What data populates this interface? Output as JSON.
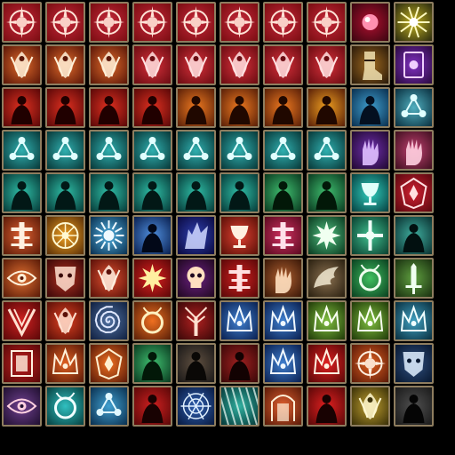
{
  "frame_color": "#8e7d5f",
  "icons": [
    {
      "name": "sun-compass-icon",
      "glyph": "compass",
      "bg": "#7a0d12",
      "mid": "#c8283a",
      "fg": "#ffe2d6"
    },
    {
      "name": "sun-compass-icon",
      "glyph": "compass",
      "bg": "#7a0d12",
      "mid": "#c8283a",
      "fg": "#ffe2d6"
    },
    {
      "name": "sun-compass-icon",
      "glyph": "compass",
      "bg": "#7a0d12",
      "mid": "#c8283a",
      "fg": "#ffe2d6"
    },
    {
      "name": "sun-compass-icon",
      "glyph": "compass",
      "bg": "#7a0d12",
      "mid": "#c8283a",
      "fg": "#ffe2d6"
    },
    {
      "name": "sun-compass-icon",
      "glyph": "compass",
      "bg": "#7a0d12",
      "mid": "#c8283a",
      "fg": "#ffe2d6"
    },
    {
      "name": "sun-compass-icon",
      "glyph": "compass",
      "bg": "#7a0d12",
      "mid": "#c8283a",
      "fg": "#ffe2d6"
    },
    {
      "name": "sun-compass-icon",
      "glyph": "compass",
      "bg": "#7a0d12",
      "mid": "#c8283a",
      "fg": "#ffe2d6"
    },
    {
      "name": "sun-compass-icon",
      "glyph": "compass",
      "bg": "#7a0d12",
      "mid": "#c8283a",
      "fg": "#ffe2d6"
    },
    {
      "name": "crimson-orb-icon",
      "glyph": "orb",
      "bg": "#3a0610",
      "mid": "#b01030",
      "fg": "#ff8fb0"
    },
    {
      "name": "lightning-burst-icon",
      "glyph": "burst",
      "bg": "#2a2a10",
      "mid": "#c0b020",
      "fg": "#fffbc0"
    },
    {
      "name": "flame-spirit-icon",
      "glyph": "flame",
      "bg": "#5a1608",
      "mid": "#e06a2a",
      "fg": "#fff0d8"
    },
    {
      "name": "flame-spirit-icon",
      "glyph": "flame",
      "bg": "#5a1608",
      "mid": "#e06a2a",
      "fg": "#fff0d8"
    },
    {
      "name": "flame-spirit-icon",
      "glyph": "flame",
      "bg": "#5a1608",
      "mid": "#e06a2a",
      "fg": "#fff0d8"
    },
    {
      "name": "flame-spirit-icon",
      "glyph": "flame",
      "bg": "#6a0c12",
      "mid": "#d8303a",
      "fg": "#ffe0e0"
    },
    {
      "name": "flame-spirit-icon",
      "glyph": "flame",
      "bg": "#6a0c12",
      "mid": "#d8303a",
      "fg": "#ffe0e0"
    },
    {
      "name": "flame-spirit-icon",
      "glyph": "flame",
      "bg": "#6a0c12",
      "mid": "#d8303a",
      "fg": "#ffe0e0"
    },
    {
      "name": "flame-spirit-icon",
      "glyph": "flame",
      "bg": "#6a0c12",
      "mid": "#d8303a",
      "fg": "#ffe0e0"
    },
    {
      "name": "flame-spirit-icon",
      "glyph": "flame",
      "bg": "#6a0c12",
      "mid": "#d8303a",
      "fg": "#ffe0e0"
    },
    {
      "name": "armored-boot-icon",
      "glyph": "boot",
      "bg": "#2a1a0a",
      "mid": "#a06a20",
      "fg": "#f0e0b0"
    },
    {
      "name": "arcane-tablet-icon",
      "glyph": "tablet",
      "bg": "#2a0a40",
      "mid": "#8030c0",
      "fg": "#f0d0ff"
    },
    {
      "name": "burning-figure-icon",
      "glyph": "figure",
      "bg": "#5a0808",
      "mid": "#e03020",
      "fg": "#200000"
    },
    {
      "name": "burning-figure-icon",
      "glyph": "figure",
      "bg": "#5a0808",
      "mid": "#e03020",
      "fg": "#200000"
    },
    {
      "name": "burning-figure-icon",
      "glyph": "figure",
      "bg": "#5a0808",
      "mid": "#e03020",
      "fg": "#200000"
    },
    {
      "name": "burning-figure-icon",
      "glyph": "figure",
      "bg": "#5a0808",
      "mid": "#e03020",
      "fg": "#200000"
    },
    {
      "name": "burning-figure-icon",
      "glyph": "figure",
      "bg": "#5a2008",
      "mid": "#f07a20",
      "fg": "#200800"
    },
    {
      "name": "burning-figure-icon",
      "glyph": "figure",
      "bg": "#5a2008",
      "mid": "#f07a20",
      "fg": "#200800"
    },
    {
      "name": "burning-figure-icon",
      "glyph": "figure",
      "bg": "#5a2008",
      "mid": "#f07a20",
      "fg": "#200800"
    },
    {
      "name": "burning-figure-icon",
      "glyph": "figure",
      "bg": "#5a2008",
      "mid": "#f0a020",
      "fg": "#200800"
    },
    {
      "name": "frost-figure-icon",
      "glyph": "figure",
      "bg": "#0a3050",
      "mid": "#40a0d0",
      "fg": "#041020"
    },
    {
      "name": "triad-sigil-icon",
      "glyph": "triad",
      "bg": "#0a3040",
      "mid": "#50b0c0",
      "fg": "#e0ffff"
    },
    {
      "name": "triad-sigil-icon",
      "glyph": "triad",
      "bg": "#083838",
      "mid": "#30b0b0",
      "fg": "#e0ffff"
    },
    {
      "name": "triad-sigil-icon",
      "glyph": "triad",
      "bg": "#083838",
      "mid": "#30b0b0",
      "fg": "#e0ffff"
    },
    {
      "name": "triad-sigil-icon",
      "glyph": "triad",
      "bg": "#083838",
      "mid": "#30b0b0",
      "fg": "#e0ffff"
    },
    {
      "name": "triad-sigil-icon",
      "glyph": "triad",
      "bg": "#083838",
      "mid": "#30b0b0",
      "fg": "#e0ffff"
    },
    {
      "name": "triad-sigil-icon",
      "glyph": "triad",
      "bg": "#083838",
      "mid": "#30b0b0",
      "fg": "#e0ffff"
    },
    {
      "name": "triad-sigil-icon",
      "glyph": "triad",
      "bg": "#083838",
      "mid": "#30b0b0",
      "fg": "#e0ffff"
    },
    {
      "name": "triad-sigil-icon",
      "glyph": "triad",
      "bg": "#083838",
      "mid": "#30b0b0",
      "fg": "#e0ffff"
    },
    {
      "name": "triad-sigil-icon",
      "glyph": "triad",
      "bg": "#083838",
      "mid": "#30b0b0",
      "fg": "#e0ffff"
    },
    {
      "name": "violet-hand-icon",
      "glyph": "hand",
      "bg": "#200830",
      "mid": "#7030b0",
      "fg": "#e0c0ff"
    },
    {
      "name": "pink-hand-icon",
      "glyph": "hand",
      "bg": "#401020",
      "mid": "#c04070",
      "fg": "#ffd0e0"
    },
    {
      "name": "shadow-figure-icon",
      "glyph": "figure",
      "bg": "#063a38",
      "mid": "#30c0a8",
      "fg": "#021816"
    },
    {
      "name": "shadow-figure-icon",
      "glyph": "figure",
      "bg": "#063a38",
      "mid": "#30c0a8",
      "fg": "#021816"
    },
    {
      "name": "shadow-figure-icon",
      "glyph": "figure",
      "bg": "#063a38",
      "mid": "#30c0a8",
      "fg": "#021816"
    },
    {
      "name": "shadow-figure-icon",
      "glyph": "figure",
      "bg": "#063a38",
      "mid": "#30c0a8",
      "fg": "#021816"
    },
    {
      "name": "shadow-figure-icon",
      "glyph": "figure",
      "bg": "#063a38",
      "mid": "#30c0a8",
      "fg": "#021816"
    },
    {
      "name": "shadow-figure-icon",
      "glyph": "figure",
      "bg": "#063a38",
      "mid": "#30c0a8",
      "fg": "#021816"
    },
    {
      "name": "shadow-figure-icon",
      "glyph": "figure",
      "bg": "#0a3a20",
      "mid": "#40c070",
      "fg": "#021808"
    },
    {
      "name": "shadow-figure-icon",
      "glyph": "figure",
      "bg": "#0a3a20",
      "mid": "#40c070",
      "fg": "#021808"
    },
    {
      "name": "ice-chalice-icon",
      "glyph": "chalice",
      "bg": "#064040",
      "mid": "#30d0c0",
      "fg": "#e0fffa"
    },
    {
      "name": "crimson-crest-icon",
      "glyph": "crest",
      "bg": "#5a0810",
      "mid": "#d02030",
      "fg": "#ffe0e0"
    },
    {
      "name": "rune-totem-icon",
      "glyph": "totem",
      "bg": "#5a1a08",
      "mid": "#e06030",
      "fg": "#fff0e0"
    },
    {
      "name": "golden-wheel-icon",
      "glyph": "wheel",
      "bg": "#5a3008",
      "mid": "#f0a020",
      "fg": "#fff8d0"
    },
    {
      "name": "radiant-sun-icon",
      "glyph": "sun",
      "bg": "#0a3050",
      "mid": "#50b0e0",
      "fg": "#f0faff"
    },
    {
      "name": "silhouette-icon",
      "glyph": "figure",
      "bg": "#0a2050",
      "mid": "#5090e0",
      "fg": "#020818"
    },
    {
      "name": "spirit-wolf-icon",
      "glyph": "wolf",
      "bg": "#0a0a40",
      "mid": "#3040b0",
      "fg": "#d0d8ff"
    },
    {
      "name": "holy-chalice-icon",
      "glyph": "chalice",
      "bg": "#5a1008",
      "mid": "#e04030",
      "fg": "#fff0e0"
    },
    {
      "name": "rune-totem-icon",
      "glyph": "totem",
      "bg": "#5a0a20",
      "mid": "#d03060",
      "fg": "#ffe0ea"
    },
    {
      "name": "spark-star-icon",
      "glyph": "star",
      "bg": "#0a3a20",
      "mid": "#50c080",
      "fg": "#f0fff0"
    },
    {
      "name": "light-cross-icon",
      "glyph": "cross",
      "bg": "#0a4030",
      "mid": "#40c090",
      "fg": "#f0fff8"
    },
    {
      "name": "phantom-icon",
      "glyph": "figure",
      "bg": "#0a3030",
      "mid": "#40b0a0",
      "fg": "#021010"
    },
    {
      "name": "sunburst-eye-icon",
      "glyph": "eye",
      "bg": "#5a1a08",
      "mid": "#e07030",
      "fg": "#fff0d8"
    },
    {
      "name": "tribal-mask-icon",
      "glyph": "mask",
      "bg": "#3a0808",
      "mid": "#b03020",
      "fg": "#ffe0d0"
    },
    {
      "name": "feather-fan-icon",
      "glyph": "flame",
      "bg": "#5a1008",
      "mid": "#e05030",
      "fg": "#fff0e0"
    },
    {
      "name": "burning-star-icon",
      "glyph": "star",
      "bg": "#5a0808",
      "mid": "#e02020",
      "fg": "#fff0a0"
    },
    {
      "name": "demon-skull-icon",
      "glyph": "skull",
      "bg": "#200820",
      "mid": "#6a2080",
      "fg": "#ffe0c0"
    },
    {
      "name": "sacred-altar-icon",
      "glyph": "totem",
      "bg": "#5a0808",
      "mid": "#d02020",
      "fg": "#ffe0e0"
    },
    {
      "name": "grasping-hand-icon",
      "glyph": "hand",
      "bg": "#3a1808",
      "mid": "#b06030",
      "fg": "#ffe0c0"
    },
    {
      "name": "stone-wing-icon",
      "glyph": "wing",
      "bg": "#2a2010",
      "mid": "#8a7050",
      "fg": "#f0e8d0"
    },
    {
      "name": "horned-ring-icon",
      "glyph": "ring",
      "bg": "#0a4020",
      "mid": "#40c060",
      "fg": "#f0fff0"
    },
    {
      "name": "holy-sword-icon",
      "glyph": "sword",
      "bg": "#1a3010",
      "mid": "#60a040",
      "fg": "#f0fff0"
    },
    {
      "name": "chevron-rune-icon",
      "glyph": "chevron",
      "bg": "#5a0808",
      "mid": "#d02020",
      "fg": "#ffe0d0"
    },
    {
      "name": "flame-spirit-icon",
      "glyph": "flame",
      "bg": "#5a1008",
      "mid": "#e04020",
      "fg": "#ffe0d0"
    },
    {
      "name": "spiral-talisman-icon",
      "glyph": "spiral",
      "bg": "#102040",
      "mid": "#5070a0",
      "fg": "#e0e8ff"
    },
    {
      "name": "fire-ring-icon",
      "glyph": "ring",
      "bg": "#5a2008",
      "mid": "#f07020",
      "fg": "#fff0c0"
    },
    {
      "name": "thorn-tree-icon",
      "glyph": "tree",
      "bg": "#3a0808",
      "mid": "#b02020",
      "fg": "#ffe0d0"
    },
    {
      "name": "frost-crown-icon",
      "glyph": "crown",
      "bg": "#0a2050",
      "mid": "#4080d0",
      "fg": "#f0f8ff"
    },
    {
      "name": "frost-crown-icon",
      "glyph": "crown",
      "bg": "#0a2050",
      "mid": "#4080d0",
      "fg": "#f0f8ff"
    },
    {
      "name": "verdant-crown-icon",
      "glyph": "crown",
      "bg": "#203a08",
      "mid": "#80c040",
      "fg": "#f8fff0"
    },
    {
      "name": "verdant-crown-icon",
      "glyph": "crown",
      "bg": "#203a08",
      "mid": "#80c040",
      "fg": "#f8fff0"
    },
    {
      "name": "frost-crown-icon",
      "glyph": "crown",
      "bg": "#0a3040",
      "mid": "#40a0c0",
      "fg": "#f0ffff"
    },
    {
      "name": "sacred-book-icon",
      "glyph": "book",
      "bg": "#5a0808",
      "mid": "#c02020",
      "fg": "#fff0e0"
    },
    {
      "name": "radiant-crown-icon",
      "glyph": "crown",
      "bg": "#5a1a08",
      "mid": "#e06020",
      "fg": "#fff0d8"
    },
    {
      "name": "golden-crest-icon",
      "glyph": "crest",
      "bg": "#5a1a08",
      "mid": "#f07020",
      "fg": "#fff0d0"
    },
    {
      "name": "verdant-figure-icon",
      "glyph": "figure",
      "bg": "#0a3a20",
      "mid": "#40c070",
      "fg": "#021808"
    },
    {
      "name": "dark-ritual-icon",
      "glyph": "figure",
      "bg": "#1a1818",
      "mid": "#605040",
      "fg": "#0a0806"
    },
    {
      "name": "blood-titan-icon",
      "glyph": "figure",
      "bg": "#3a0808",
      "mid": "#a02020",
      "fg": "#120202"
    },
    {
      "name": "frost-crown-icon",
      "glyph": "crown",
      "bg": "#0a2050",
      "mid": "#4080d0",
      "fg": "#f0f8ff"
    },
    {
      "name": "flame-crown-icon",
      "glyph": "crown",
      "bg": "#5a0808",
      "mid": "#e02020",
      "fg": "#fff0e0"
    },
    {
      "name": "sun-compass-icon",
      "glyph": "compass",
      "bg": "#5a1a08",
      "mid": "#e06020",
      "fg": "#fff0e0"
    },
    {
      "name": "dark-sigil-icon",
      "glyph": "mask",
      "bg": "#081830",
      "mid": "#305080",
      "fg": "#e0f0ff"
    },
    {
      "name": "void-eye-icon",
      "glyph": "eye",
      "bg": "#201030",
      "mid": "#704090",
      "fg": "#ffd0e0"
    },
    {
      "name": "frost-shield-icon",
      "glyph": "ring",
      "bg": "#064040",
      "mid": "#30c0c0",
      "fg": "#f0ffff"
    },
    {
      "name": "triad-sigil-icon",
      "glyph": "triad",
      "bg": "#0a3050",
      "mid": "#40a0d0",
      "fg": "#e0f8ff"
    },
    {
      "name": "blood-figure-icon",
      "glyph": "figure",
      "bg": "#5a0808",
      "mid": "#d02020",
      "fg": "#180202"
    },
    {
      "name": "frost-web-icon",
      "glyph": "web",
      "bg": "#081a40",
      "mid": "#3060b0",
      "fg": "#e0f0ff"
    },
    {
      "name": "frost-light-icon",
      "glyph": "rays",
      "bg": "#063a3a",
      "mid": "#30b0a0",
      "fg": "#f0fff8"
    },
    {
      "name": "ember-gate-icon",
      "glyph": "gate",
      "bg": "#5a1a08",
      "mid": "#e06030",
      "fg": "#fff0d8"
    },
    {
      "name": "crimson-figure-icon",
      "glyph": "figure",
      "bg": "#5a0808",
      "mid": "#e02020",
      "fg": "#180202"
    },
    {
      "name": "golden-feather-icon",
      "glyph": "flame",
      "bg": "#3a3008",
      "mid": "#c0a030",
      "fg": "#fff8d0"
    },
    {
      "name": "shadow-hood-icon",
      "glyph": "figure",
      "bg": "#1a1a1a",
      "mid": "#505050",
      "fg": "#050505"
    }
  ]
}
